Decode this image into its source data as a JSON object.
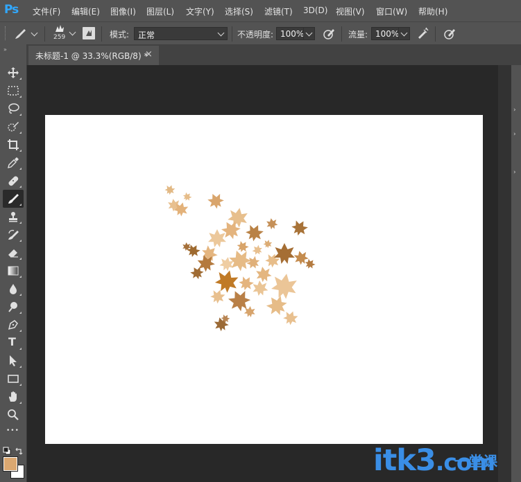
{
  "app": {
    "logo": "Ps"
  },
  "menu": [
    {
      "id": "file",
      "label": "文件(F)"
    },
    {
      "id": "edit",
      "label": "编辑(E)"
    },
    {
      "id": "image",
      "label": "图像(I)"
    },
    {
      "id": "layer",
      "label": "图层(L)"
    },
    {
      "id": "type",
      "label": "文字(Y)"
    },
    {
      "id": "select",
      "label": "选择(S)"
    },
    {
      "id": "filter",
      "label": "滤镜(T)"
    },
    {
      "id": "3d",
      "label": "3D(D)"
    },
    {
      "id": "view",
      "label": "视图(V)"
    },
    {
      "id": "window",
      "label": "窗口(W)"
    },
    {
      "id": "help",
      "label": "帮助(H)"
    }
  ],
  "options": {
    "brush_size": "259",
    "mode_label": "模式:",
    "mode_value": "正常",
    "opacity_label": "不透明度:",
    "opacity_value": "100%",
    "flow_label": "流量:",
    "flow_value": "100%"
  },
  "document": {
    "tab_title": "未标题-1 @ 33.3%(RGB/8) *",
    "close_glyph": "×",
    "zoom": "33.3%"
  },
  "colors": {
    "foreground": "#dba871",
    "background": "#ffffff",
    "ui_panel": "#535353",
    "workspace": "#282828"
  },
  "tools": [
    {
      "name": "move-tool",
      "icon": "move-icon"
    },
    {
      "name": "marquee-tool",
      "icon": "marquee-icon"
    },
    {
      "name": "lasso-tool",
      "icon": "lasso-icon"
    },
    {
      "name": "quick-selection-tool",
      "icon": "quick-selection-icon"
    },
    {
      "name": "crop-tool",
      "icon": "crop-icon"
    },
    {
      "name": "eyedropper-tool",
      "icon": "eyedropper-icon"
    },
    {
      "name": "healing-brush-tool",
      "icon": "bandage-icon"
    },
    {
      "name": "brush-tool",
      "icon": "brush-icon",
      "active": true
    },
    {
      "name": "clone-stamp-tool",
      "icon": "stamp-icon"
    },
    {
      "name": "history-brush-tool",
      "icon": "history-brush-icon"
    },
    {
      "name": "eraser-tool",
      "icon": "eraser-icon"
    },
    {
      "name": "gradient-tool",
      "icon": "gradient-icon"
    },
    {
      "name": "blur-tool",
      "icon": "drop-icon"
    },
    {
      "name": "dodge-tool",
      "icon": "dodge-icon"
    },
    {
      "name": "pen-tool",
      "icon": "pen-icon"
    },
    {
      "name": "type-tool",
      "icon": "type-icon",
      "glyph": "T"
    },
    {
      "name": "path-selection-tool",
      "icon": "arrow-icon"
    },
    {
      "name": "rectangle-tool",
      "icon": "rectangle-icon"
    },
    {
      "name": "hand-tool",
      "icon": "hand-icon"
    },
    {
      "name": "zoom-tool",
      "icon": "zoom-icon"
    },
    {
      "name": "more-tools",
      "icon": "ellipsis-icon",
      "glyph": "•••"
    }
  ],
  "watermark": {
    "text": "itk3",
    "suffix": ".com",
    "cn": "一堂课"
  }
}
